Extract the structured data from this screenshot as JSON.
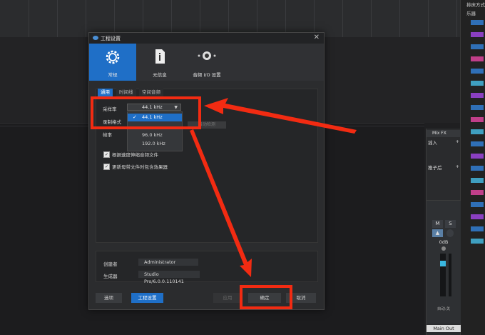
{
  "background": {
    "right_panel_texts": [
      "排床方式",
      "乐器"
    ],
    "mixer": {
      "fx_header": "Mix FX",
      "insert_label": "插入",
      "send_label": "推子后",
      "mute_label": "M",
      "solo_label": "S",
      "level": "0dB",
      "auto_label": "自动:关",
      "channel_name": "Main Out"
    }
  },
  "dialog": {
    "title": "工程设置",
    "categories": [
      {
        "label": "常规",
        "icon": "gear-icon",
        "active": true
      },
      {
        "label": "元信息",
        "icon": "info-icon",
        "active": false
      },
      {
        "label": "音频 I/O 设置",
        "icon": "speaker-icon",
        "active": false
      }
    ],
    "tabs": [
      "通用",
      "时间线",
      "空间音频"
    ],
    "sample_rate_label": "采样率",
    "sample_rate_value": "44.1 kHz",
    "format_label": "录制格式",
    "framerate_label": "帧率",
    "sample_rate_options": [
      "44.1 kHz",
      "96.0 kHz",
      "192.0 kHz"
    ],
    "disabled_button": "自动检测",
    "checkbox_1": "根据速度伸缩音频文件",
    "checkbox_2": "更新母带文件时包含效果器",
    "creator_label": "创建者",
    "creator_value": "Administrator",
    "generator_label": "生成器",
    "generator_value": "Studio Pro/6.0.0.110141",
    "buttons": {
      "options": "选项",
      "project_settings": "工程设置",
      "apply": "应用",
      "ok": "确定",
      "cancel": "取消"
    }
  },
  "colors": {
    "accent": "#1f6fc7",
    "annotation": "#f22b12"
  }
}
